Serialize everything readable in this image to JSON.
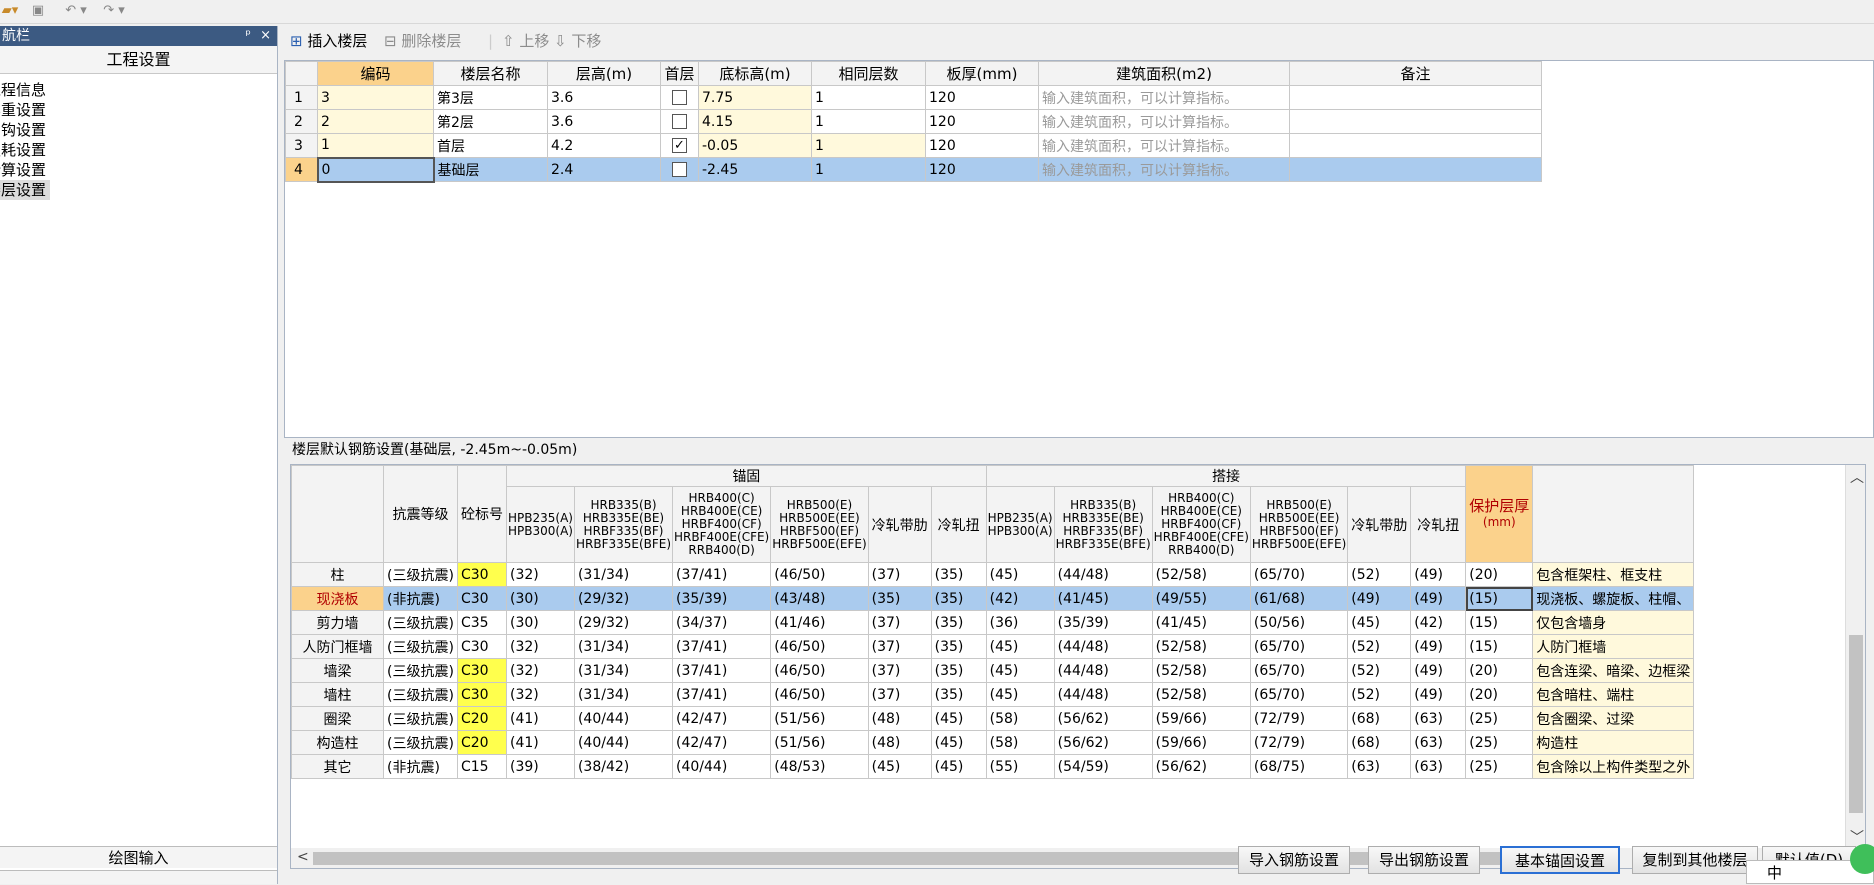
{
  "qat": {
    "icons": [
      "app-menu-icon",
      "save-icon",
      "undo-icon",
      "redo-icon"
    ]
  },
  "nav": {
    "title": "航栏",
    "pin": "ᵖ",
    "close": "×",
    "project_tab": "工程设置",
    "items": [
      "工程信息",
      "比重设置",
      "弯钩设置",
      "损耗设置",
      "计算设置",
      "楼层设置"
    ],
    "bottom_tab": "绘图输入"
  },
  "toolbar": {
    "insert": "插入楼层",
    "delete": "删除楼层",
    "up": "上移",
    "down": "下移"
  },
  "floors": {
    "headers": [
      "编码",
      "楼层名称",
      "层高(m)",
      "首层",
      "底标高(m)",
      "相同层数",
      "板厚(mm)",
      "建筑面积(m2)",
      "备注"
    ],
    "rows": [
      {
        "n": "1",
        "code": "3",
        "name": "第3层",
        "h": "3.6",
        "first": false,
        "elev": "7.75",
        "same": "1",
        "thick": "120",
        "area": "输入建筑面积，可以计算指标。",
        "note": ""
      },
      {
        "n": "2",
        "code": "2",
        "name": "第2层",
        "h": "3.6",
        "first": false,
        "elev": "4.15",
        "same": "1",
        "thick": "120",
        "area": "输入建筑面积，可以计算指标。",
        "note": ""
      },
      {
        "n": "3",
        "code": "1",
        "name": "首层",
        "h": "4.2",
        "first": true,
        "elev": "-0.05",
        "same": "1",
        "thick": "120",
        "area": "输入建筑面积，可以计算指标。",
        "note": ""
      },
      {
        "n": "4",
        "code": "0",
        "name": "基础层",
        "h": "2.4",
        "first": false,
        "elev": "-2.45",
        "same": "1",
        "thick": "120",
        "area": "输入建筑面积，可以计算指标。",
        "note": ""
      }
    ]
  },
  "rebar": {
    "title": "楼层默认钢筋设置(基础层, -2.45m~-0.05m)",
    "group_anchor": "锚固",
    "group_lap": "搭接",
    "h_seismic": "抗震等级",
    "h_concrete": "砼标号",
    "steel": [
      "HPB235(A) HPB300(A)",
      "HRB335(B) HRB335E(BE) HRBF335(BF) HRBF335E(BFE)",
      "HRB400(C) HRB400E(CE) HRBF400(CF) HRBF400E(CFE) RRB400(D)",
      "HRB500(E) HRB500E(EE) HRBF500(EF) HRBF500E(EFE)",
      "冷轧带肋",
      "冷轧扭"
    ],
    "h_cover": "保护层厚",
    "h_cover_unit": "(mm)",
    "rows": [
      {
        "name": "柱",
        "seis": "(三级抗震)",
        "conc": "C30",
        "cy": true,
        "v": [
          "(32)",
          "(31/34)",
          "(37/41)",
          "(46/50)",
          "(37)",
          "(35)",
          "(45)",
          "(44/48)",
          "(52/58)",
          "(65/70)",
          "(52)",
          "(49)",
          "(20)"
        ],
        "note": "包含框架柱、框支柱"
      },
      {
        "name": "现浇板",
        "seis": "(非抗震)",
        "conc": "C30",
        "cy": false,
        "v": [
          "(30)",
          "(29/32)",
          "(35/39)",
          "(43/48)",
          "(35)",
          "(35)",
          "(42)",
          "(41/45)",
          "(49/55)",
          "(61/68)",
          "(49)",
          "(49)",
          "(15)"
        ],
        "note": "现浇板、螺旋板、柱帽、"
      },
      {
        "name": "剪力墙",
        "seis": "(三级抗震)",
        "conc": "C35",
        "cy": false,
        "v": [
          "(30)",
          "(29/32)",
          "(34/37)",
          "(41/46)",
          "(37)",
          "(35)",
          "(36)",
          "(35/39)",
          "(41/45)",
          "(50/56)",
          "(45)",
          "(42)",
          "(15)"
        ],
        "note": "仅包含墙身"
      },
      {
        "name": "人防门框墙",
        "seis": "(三级抗震)",
        "conc": "C30",
        "cy": false,
        "v": [
          "(32)",
          "(31/34)",
          "(37/41)",
          "(46/50)",
          "(37)",
          "(35)",
          "(45)",
          "(44/48)",
          "(52/58)",
          "(65/70)",
          "(52)",
          "(49)",
          "(15)"
        ],
        "note": "人防门框墙"
      },
      {
        "name": "墙梁",
        "seis": "(三级抗震)",
        "conc": "C30",
        "cy": true,
        "v": [
          "(32)",
          "(31/34)",
          "(37/41)",
          "(46/50)",
          "(37)",
          "(35)",
          "(45)",
          "(44/48)",
          "(52/58)",
          "(65/70)",
          "(52)",
          "(49)",
          "(20)"
        ],
        "note": "包含连梁、暗梁、边框梁"
      },
      {
        "name": "墙柱",
        "seis": "(三级抗震)",
        "conc": "C30",
        "cy": true,
        "v": [
          "(32)",
          "(31/34)",
          "(37/41)",
          "(46/50)",
          "(37)",
          "(35)",
          "(45)",
          "(44/48)",
          "(52/58)",
          "(65/70)",
          "(52)",
          "(49)",
          "(20)"
        ],
        "note": "包含暗柱、端柱"
      },
      {
        "name": "圈梁",
        "seis": "(三级抗震)",
        "conc": "C20",
        "cy": true,
        "v": [
          "(41)",
          "(40/44)",
          "(42/47)",
          "(51/56)",
          "(48)",
          "(45)",
          "(58)",
          "(56/62)",
          "(59/66)",
          "(72/79)",
          "(68)",
          "(63)",
          "(25)"
        ],
        "note": "包含圈梁、过梁"
      },
      {
        "name": "构造柱",
        "seis": "(三级抗震)",
        "conc": "C20",
        "cy": true,
        "v": [
          "(41)",
          "(40/44)",
          "(42/47)",
          "(51/56)",
          "(48)",
          "(45)",
          "(58)",
          "(56/62)",
          "(59/66)",
          "(72/79)",
          "(68)",
          "(63)",
          "(25)"
        ],
        "note": "构造柱"
      },
      {
        "name": "其它",
        "seis": "(非抗震)",
        "conc": "C15",
        "cy": false,
        "v": [
          "(39)",
          "(38/42)",
          "(40/44)",
          "(48/53)",
          "(45)",
          "(45)",
          "(55)",
          "(54/59)",
          "(56/62)",
          "(68/75)",
          "(63)",
          "(63)",
          "(25)"
        ],
        "note": "包含除以上构件类型之外"
      }
    ]
  },
  "buttons": {
    "import": "导入钢筋设置",
    "export": "导出钢筋设置",
    "basic": "基本锚固设置",
    "copy": "复制到其他楼层",
    "default": "默认值(D)"
  },
  "ime": "中"
}
